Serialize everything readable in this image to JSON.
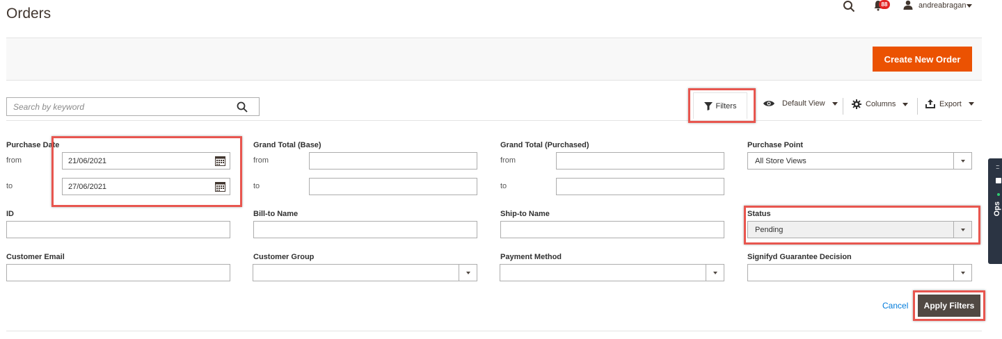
{
  "page": {
    "title": "Orders"
  },
  "header": {
    "notification_count": "88",
    "username": "andreabragan"
  },
  "actions": {
    "create_label": "Create New Order"
  },
  "search": {
    "placeholder": "Search by keyword"
  },
  "toolbar": {
    "filters_label": "Filters",
    "view_label": "Default View",
    "columns_label": "Columns",
    "export_label": "Export"
  },
  "filters": {
    "purchase_date": {
      "label": "Purchase Date",
      "from_label": "from",
      "to_label": "to",
      "from_value": "21/06/2021",
      "to_value": "27/06/2021"
    },
    "grand_total_base": {
      "label": "Grand Total (Base)",
      "from_label": "from",
      "to_label": "to"
    },
    "grand_total_purchased": {
      "label": "Grand Total (Purchased)",
      "from_label": "from",
      "to_label": "to"
    },
    "purchase_point": {
      "label": "Purchase Point",
      "value": "All Store Views"
    },
    "id": {
      "label": "ID"
    },
    "bill_to_name": {
      "label": "Bill-to Name"
    },
    "ship_to_name": {
      "label": "Ship-to Name"
    },
    "status": {
      "label": "Status",
      "value": "Pending"
    },
    "customer_email": {
      "label": "Customer Email"
    },
    "customer_group": {
      "label": "Customer Group"
    },
    "payment_method": {
      "label": "Payment Method"
    },
    "signifyd": {
      "label": "Signifyd Guarantee Decision"
    },
    "cancel_label": "Cancel",
    "apply_label": "Apply Filters"
  },
  "side_panel": {
    "label": "Ops"
  },
  "colors": {
    "accent": "#eb5202",
    "apply_button": "#514943",
    "highlight": "#e8564f",
    "link": "#007bdb"
  }
}
